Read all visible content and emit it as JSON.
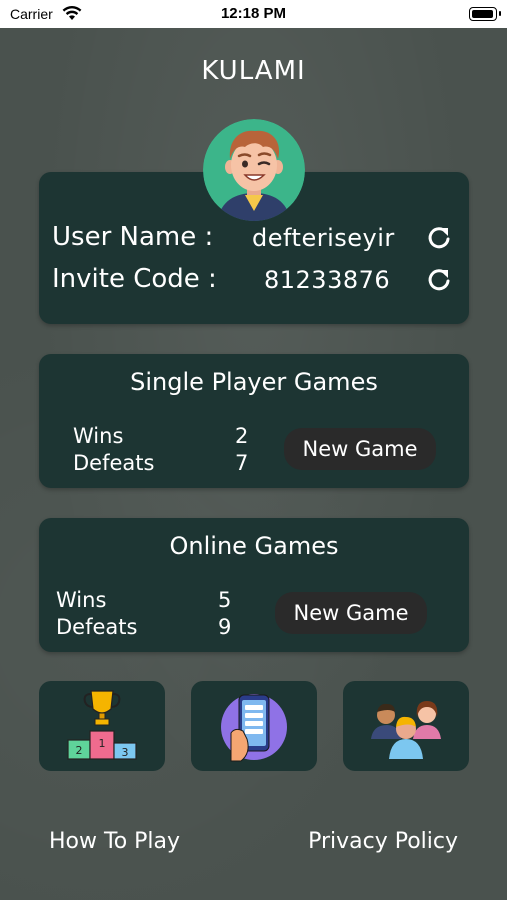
{
  "status_bar": {
    "carrier": "Carrier",
    "time": "12:18 PM"
  },
  "app": {
    "title": "KULAMI"
  },
  "profile": {
    "user_name_label": "User Name :",
    "user_name_value": "defteriseyir",
    "invite_code_label": "Invite Code :",
    "invite_code_value": "81233876"
  },
  "single_player": {
    "title": "Single Player Games",
    "wins_label": "Wins",
    "wins_value": "2",
    "defeats_label": "Defeats",
    "defeats_value": "7",
    "button_label": "New Game"
  },
  "online": {
    "title": "Online Games",
    "wins_label": "Wins",
    "wins_value": "5",
    "defeats_label": "Defeats",
    "defeats_value": "9",
    "button_label": "New Game"
  },
  "tiles": [
    {
      "icon": "podium-trophy-icon"
    },
    {
      "icon": "phone-list-icon"
    },
    {
      "icon": "group-players-icon"
    }
  ],
  "footer": {
    "how_to_play": "How To Play",
    "privacy_policy": "Privacy Policy"
  },
  "colors": {
    "background": "#4a524e",
    "card": "#1d3533",
    "button": "#2a2a2a",
    "text": "#ffffff"
  }
}
